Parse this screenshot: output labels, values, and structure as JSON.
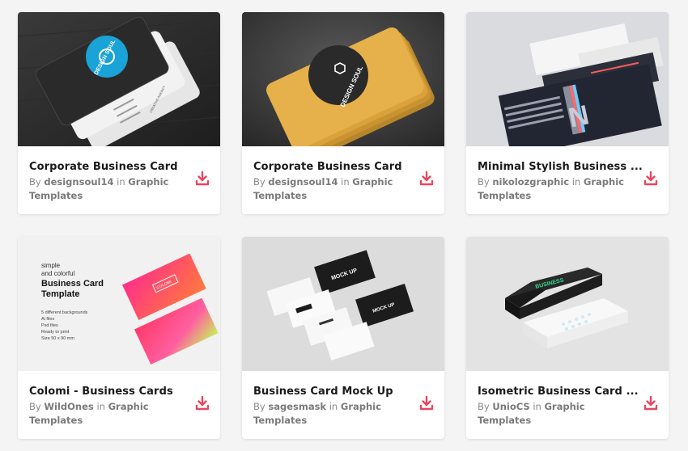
{
  "labels": {
    "by": "By",
    "in": "in"
  },
  "accent_color": "#e8475f",
  "items": [
    {
      "title": "Corporate Business Card",
      "author": "designsoul14",
      "category": "Graphic Templates",
      "download_icon": "download-icon"
    },
    {
      "title": "Corporate Business Card",
      "author": "designsoul14",
      "category": "Graphic Templates",
      "download_icon": "download-icon"
    },
    {
      "title": "Minimal Stylish Business ...",
      "author": "nikolozgraphic",
      "category": "Graphic Templates",
      "download_icon": "download-icon"
    },
    {
      "title": "Colomi - Business Cards",
      "author": "WildOnes",
      "category": "Graphic Templates",
      "download_icon": "download-icon"
    },
    {
      "title": "Business Card Mock Up",
      "author": "sagesmask",
      "category": "Graphic Templates",
      "download_icon": "download-icon"
    },
    {
      "title": "Isometric Business Card ...",
      "author": "UnioCS",
      "category": "Graphic Templates",
      "download_icon": "download-icon"
    }
  ],
  "previews": {
    "p1": {
      "brand": "DESIGN SOUL",
      "sub": "CREATIVE AGENCY"
    },
    "p2": {
      "brand": "DESIGN SOUL"
    },
    "p3": {
      "monogram": "N"
    },
    "p4": {
      "line1": "simple",
      "line2": "and colorful",
      "heading1": "Business Card",
      "heading2": "Template",
      "feat1": "5 different backgrounds",
      "feat2": "Ai files",
      "feat3": "Psd files",
      "feat4": "Ready to print",
      "feat5": "Size 50 x 90 mm",
      "card_label": "COLOMI"
    },
    "p5": {
      "mock": "MOCK UP"
    },
    "p6": {
      "brand": "BUSINESS"
    }
  }
}
